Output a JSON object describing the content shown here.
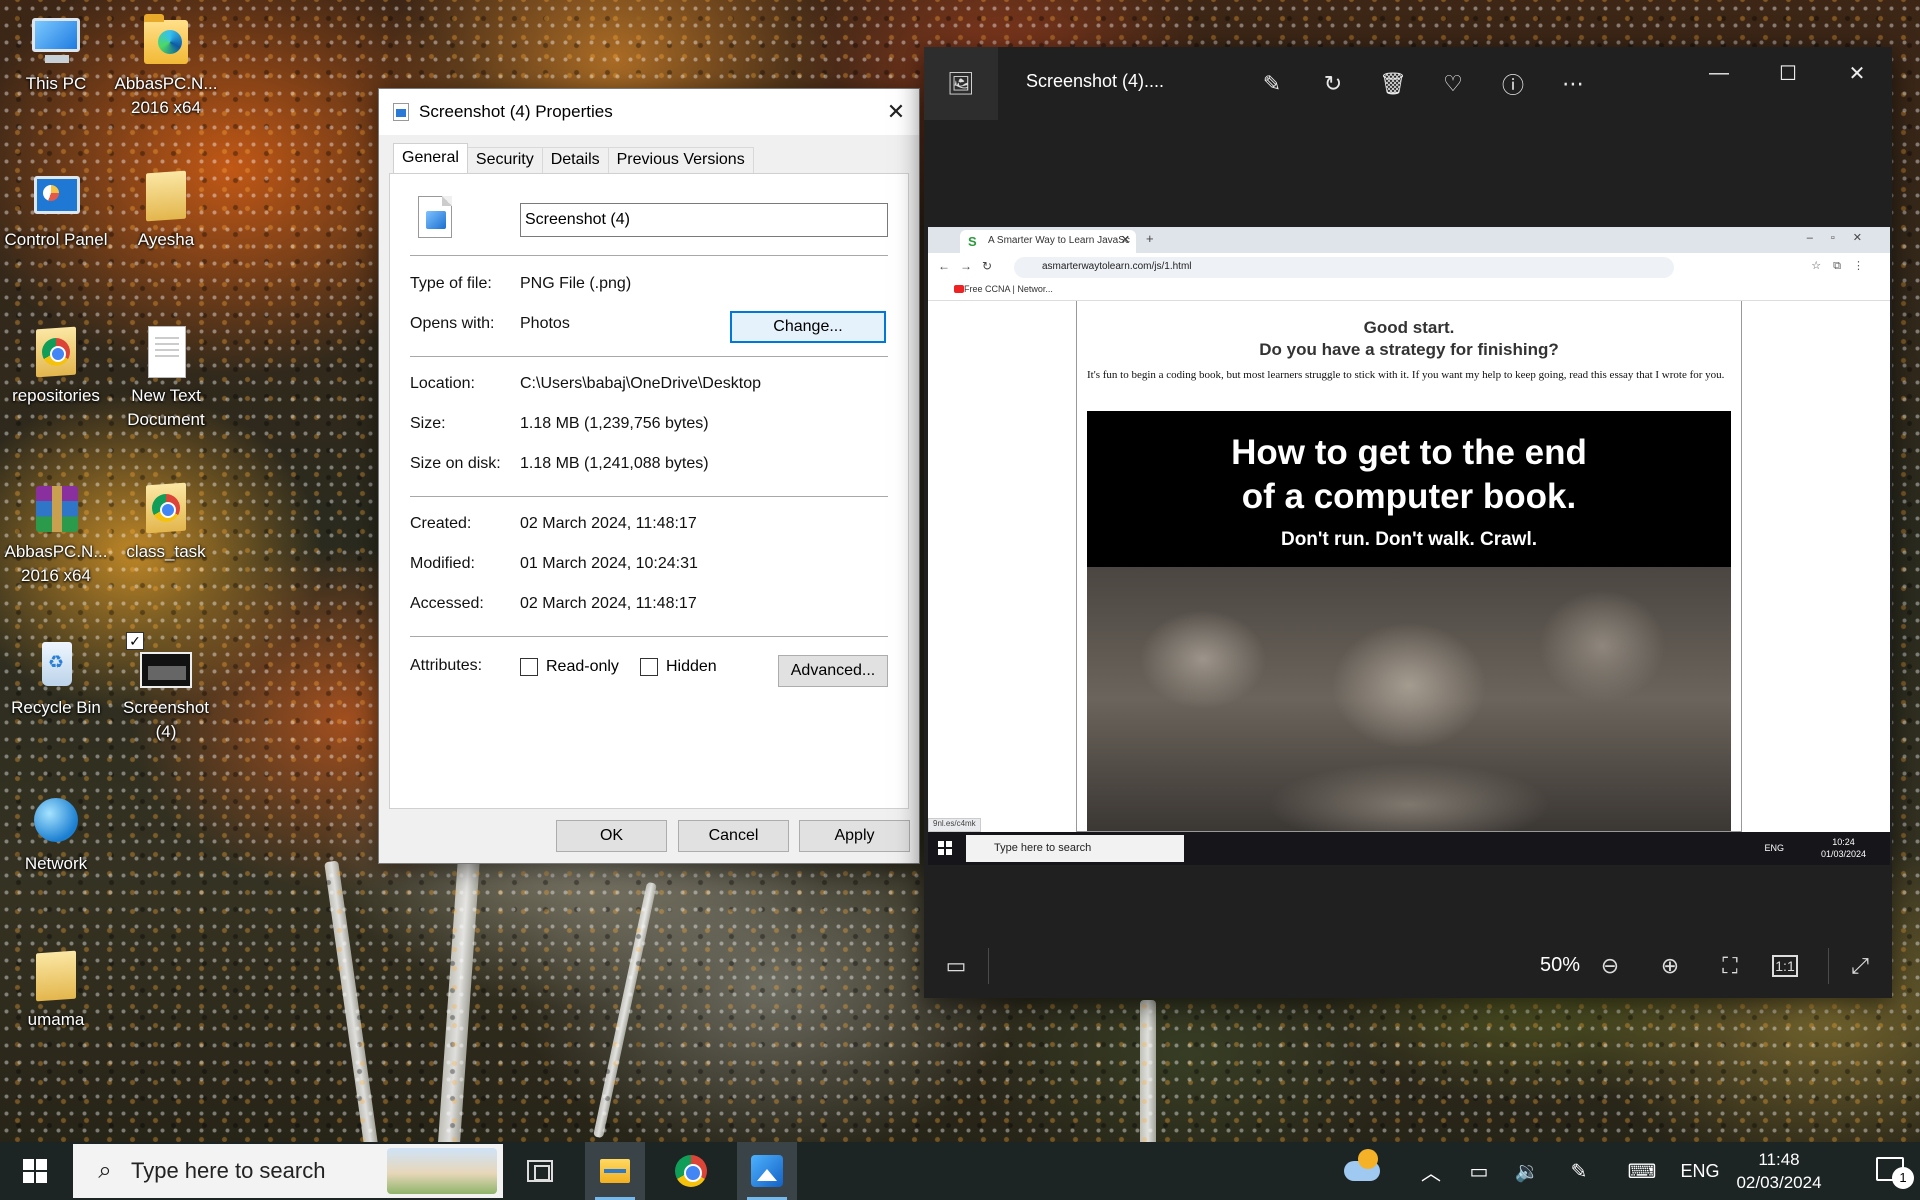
{
  "desktop": {
    "icons": [
      {
        "label": "This PC"
      },
      {
        "label": "AbbasPC.N... 2016 x64"
      },
      {
        "label": "Control Panel"
      },
      {
        "label": "Ayesha"
      },
      {
        "label": "repositories"
      },
      {
        "label": "New Text Document"
      },
      {
        "label": "AbbasPC.N... 2016 x64"
      },
      {
        "label": "class_task"
      },
      {
        "label": "Recycle Bin"
      },
      {
        "label": "Screenshot (4)"
      },
      {
        "label": "Network"
      },
      {
        "label": "umama"
      }
    ]
  },
  "properties_dialog": {
    "title": "Screenshot (4) Properties",
    "tabs": [
      "General",
      "Security",
      "Details",
      "Previous Versions"
    ],
    "active_tab": "General",
    "file_name": "Screenshot (4)",
    "type_label": "Type of file:",
    "type_value": "PNG File (.png)",
    "opens_label": "Opens with:",
    "opens_value": "Photos",
    "change_button": "Change...",
    "location_label": "Location:",
    "location_value": "C:\\Users\\babaj\\OneDrive\\Desktop",
    "size_label": "Size:",
    "size_value": "1.18 MB (1,239,756 bytes)",
    "size_disk_label": "Size on disk:",
    "size_disk_value": "1.18 MB (1,241,088 bytes)",
    "created_label": "Created:",
    "created_value": "02 March 2024, 11:48:17",
    "modified_label": "Modified:",
    "modified_value": "01 March 2024, 10:24:31",
    "accessed_label": "Accessed:",
    "accessed_value": "02 March 2024, 11:48:17",
    "attributes_label": "Attributes:",
    "readonly_label": "Read-only",
    "hidden_label": "Hidden",
    "advanced_button": "Advanced...",
    "ok_button": "OK",
    "cancel_button": "Cancel",
    "apply_button": "Apply"
  },
  "photos_viewer": {
    "title": "Screenshot (4)....",
    "zoom": "50%",
    "icons": [
      "photos-app-icon",
      "edit-image-icon",
      "rotate-icon",
      "delete-icon",
      "heart-icon",
      "info-icon",
      "more-icon",
      "minimize-icon",
      "maximize-icon",
      "close-icon",
      "filmstrip-icon",
      "zoom-out-icon",
      "zoom-in-icon",
      "fit-icon",
      "actual-size-icon",
      "expand-icon"
    ],
    "actual_size_label": "1:1",
    "inner_screenshot": {
      "tab_title": "A Smarter Way to Learn JavaSc",
      "url": "asmarterwaytolearn.com/js/1.html",
      "bookmark": "Free CCNA | Networ...",
      "heading_line1": "Good start.",
      "heading_line2": "Do you have a strategy for finishing?",
      "paragraph": "It's fun to begin a coding book, but most learners struggle to stick with it. If you want my help to keep going, read this essay that I wrote for you.",
      "banner_line1": "How to get to the end",
      "banner_line2": "of a computer book.",
      "banner_line3": "Don't run. Don't walk. Crawl.",
      "status_hint": "9nl.es/c4mk",
      "taskbar_search": "Type here to search",
      "taskbar_lang": "ENG",
      "taskbar_time": "10:24",
      "taskbar_date": "01/03/2024"
    }
  },
  "taskbar": {
    "search_placeholder": "Type here to search",
    "language": "ENG",
    "time": "11:48",
    "date": "02/03/2024",
    "notification_count": "1"
  }
}
